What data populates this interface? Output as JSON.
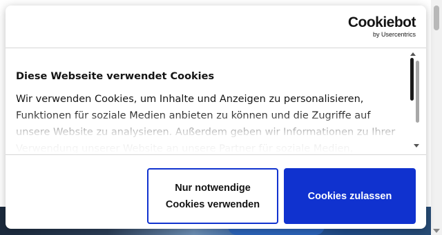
{
  "banner": {
    "logo": {
      "main": "Cookiebot",
      "sub": "by Usercentrics"
    },
    "heading": "Diese Webseite verwendet Cookies",
    "body": "Wir verwenden Cookies, um Inhalte und Anzeigen zu personalisieren, Funktionen für soziale Medien anbieten zu können und die Zugriffe auf unsere Website zu analysieren. Außerdem geben wir Informationen zu Ihrer Verwendung unserer Website an unsere Partner für soziale Medien,",
    "buttons": {
      "necessary_line1": "Nur notwendige",
      "necessary_line2": "Cookies verwenden",
      "allow": "Cookies zulassen"
    }
  },
  "colors": {
    "accent": "#1032cf",
    "text": "#141414",
    "divider": "#d6d6d6"
  },
  "icons": [
    "cookiebot-logo",
    "scroll-up-icon",
    "scroll-down-icon"
  ]
}
